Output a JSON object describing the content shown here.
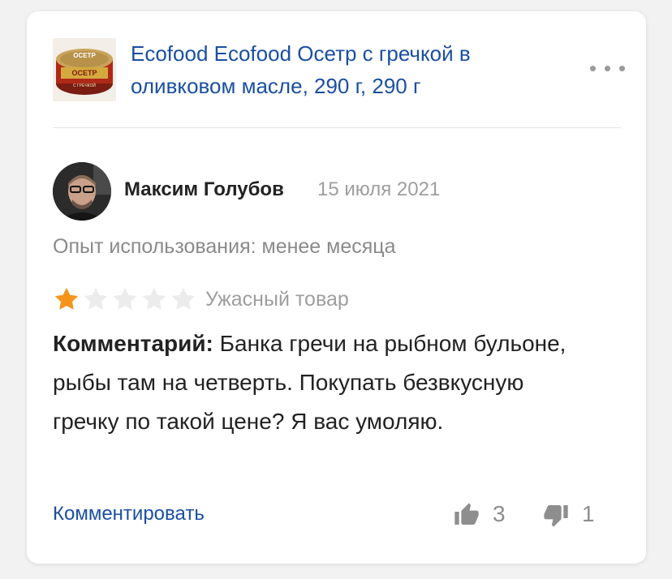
{
  "product": {
    "title": "Ecofood Ecofood Осетр с гречкой в оливковом масле, 290 г, 290 г",
    "thumb_text_top": "ОСЕТР",
    "thumb_text_mid": "ОСЕТР",
    "thumb_text_bottom": "С ГРЕЧКОЙ"
  },
  "review": {
    "author": "Максим Голубов",
    "date": "15 июля 2021",
    "experience": "Опыт использования: менее месяца",
    "rating": 1,
    "rating_max": 5,
    "rating_label": "Ужасный товар",
    "comment_label": "Комментарий:",
    "comment_text": " Банка гречи на рыбном бульоне, рыбы там на четверть. Покупать безвкусную гречку по такой цене? Я вас умоляю."
  },
  "actions": {
    "comment_link": "Комментировать",
    "likes": "3",
    "dislikes": "1"
  },
  "colors": {
    "link": "#1a4fa3",
    "star_active": "#f6941c",
    "star_inactive": "#ececec"
  }
}
